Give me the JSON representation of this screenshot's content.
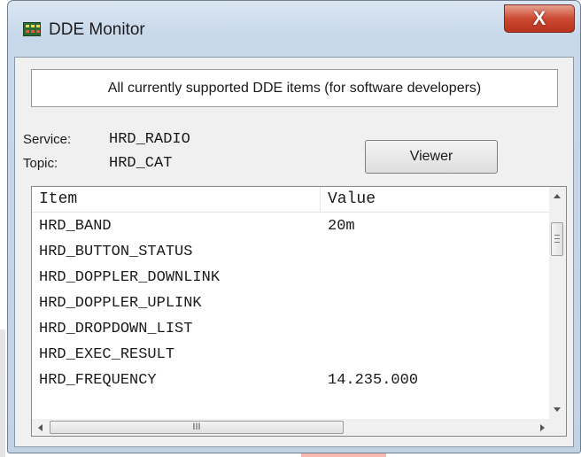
{
  "window": {
    "title": "DDE Monitor",
    "close_glyph": "X",
    "icon": "dde-app-icon"
  },
  "banner": {
    "text": "All currently supported DDE items (for software developers)"
  },
  "service": {
    "label": "Service:",
    "value": "HRD_RADIO"
  },
  "topic": {
    "label": "Topic:",
    "value": "HRD_CAT"
  },
  "viewer_button": {
    "label": "Viewer"
  },
  "list": {
    "columns": [
      "Item",
      "Value"
    ],
    "rows": [
      {
        "item": "HRD_BAND",
        "value": "20m"
      },
      {
        "item": "HRD_BUTTON_STATUS",
        "value": ""
      },
      {
        "item": "HRD_DOPPLER_DOWNLINK",
        "value": ""
      },
      {
        "item": "HRD_DOPPLER_UPLINK",
        "value": ""
      },
      {
        "item": "HRD_DROPDOWN_LIST",
        "value": ""
      },
      {
        "item": "HRD_EXEC_RESULT",
        "value": ""
      },
      {
        "item": "HRD_FREQUENCY",
        "value": "14.235.000"
      }
    ],
    "hscroll_grip": "III"
  },
  "colors": {
    "close_button": "#cc4a32",
    "title_bar": "#c7d8ea"
  }
}
